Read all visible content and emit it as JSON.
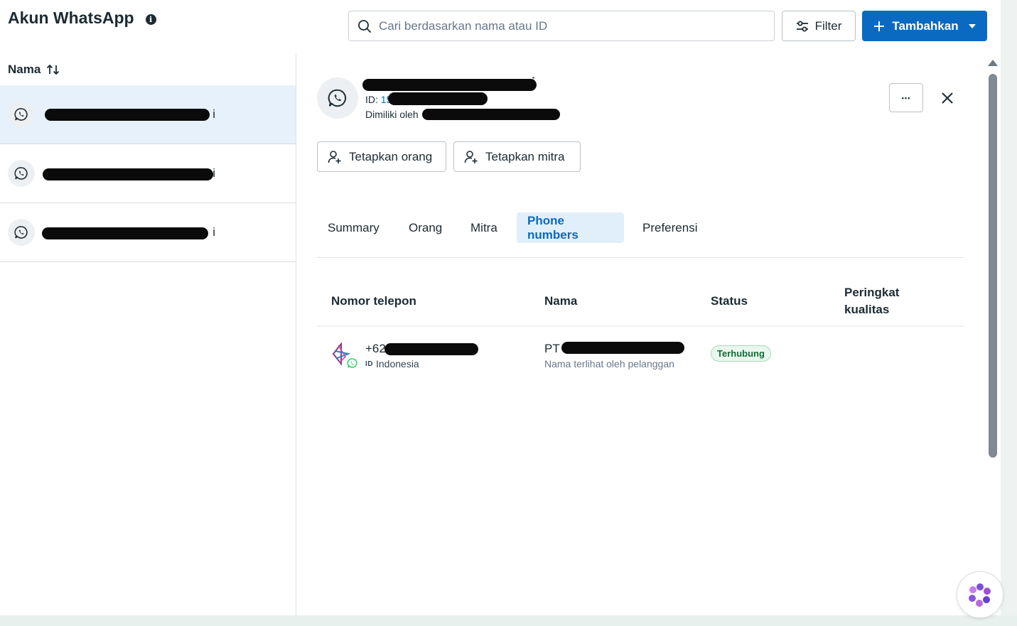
{
  "header": {
    "title": "Akun WhatsApp",
    "info_icon": "info-icon",
    "search_placeholder": "Cari berdasarkan nama atau ID",
    "filter_label": "Filter",
    "add_label": "Tambahkan"
  },
  "list": {
    "sort_label": "Nama",
    "items": [
      {
        "label": "i",
        "selected": true
      },
      {
        "label": "i",
        "selected": false
      },
      {
        "label": "i",
        "selected": false
      }
    ]
  },
  "detail": {
    "name": "i",
    "id_label": "ID:",
    "id_value": "15",
    "owner_label": "Dimiliki oleh",
    "assign_person_label": "Tetapkan orang",
    "assign_partner_label": "Tetapkan mitra",
    "more_label": "•••"
  },
  "tabs": [
    {
      "label": "Summary",
      "active": false
    },
    {
      "label": "Orang",
      "active": false
    },
    {
      "label": "Mitra",
      "active": false
    },
    {
      "label": "Phone numbers",
      "active": true
    },
    {
      "label": "Preferensi",
      "active": false
    }
  ],
  "table": {
    "columns": [
      "Nomor telepon",
      "Nama",
      "Status",
      "Peringkat kualitas"
    ],
    "rows": [
      {
        "phone": "+62",
        "country_code": "ID",
        "country": "Indonesia",
        "name": "PT",
        "name_sub": "Nama terlihat oleh pelanggan",
        "status": "Terhubung"
      }
    ]
  },
  "colors": {
    "accent": "#0a6ac2",
    "selected_row": "#e6f1fc",
    "status_green": "#136b35"
  }
}
